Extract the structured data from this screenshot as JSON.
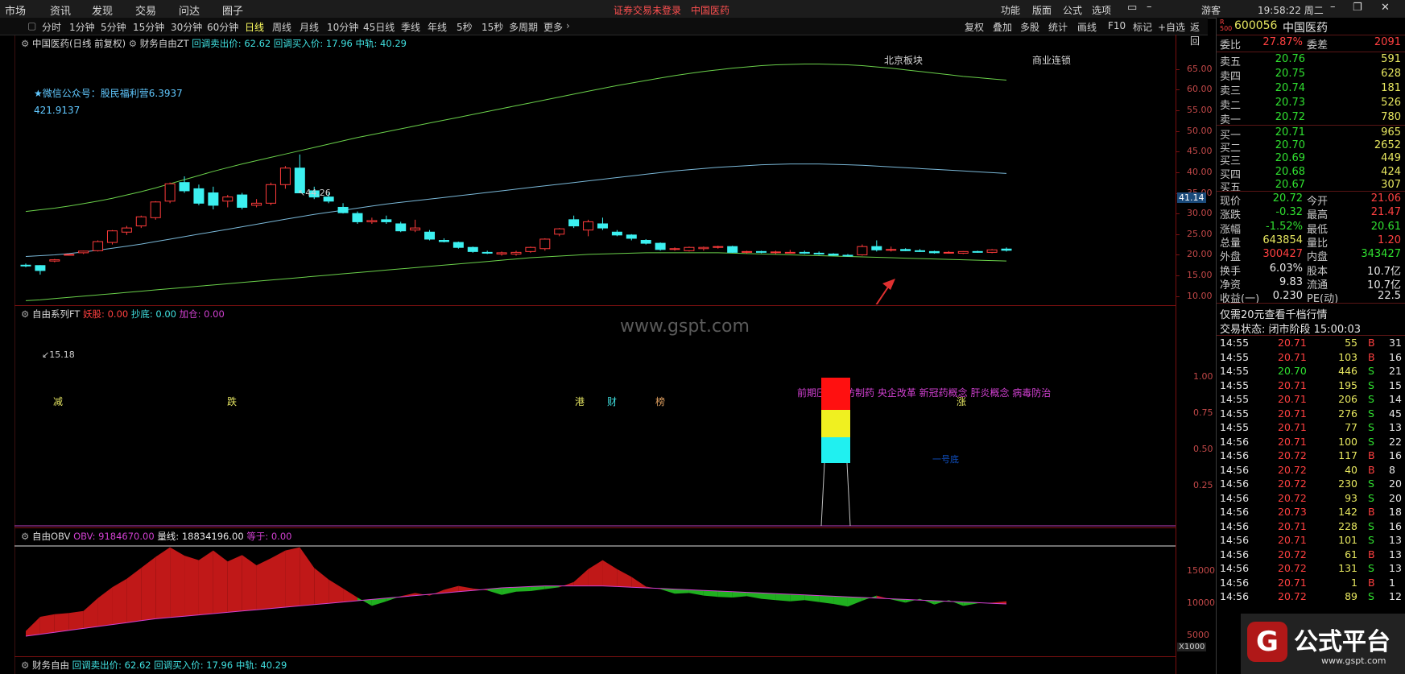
{
  "menu": {
    "items": [
      "市场",
      "资讯",
      "发现",
      "交易",
      "问达",
      "圈子"
    ],
    "notice": "证券交易未登录",
    "stock_title": "中国医药",
    "right_items": [
      "功能",
      "版面",
      "公式",
      "选项"
    ],
    "user": "游客",
    "clock": "19:58:22 周二"
  },
  "toolbar": {
    "periods": [
      "分时",
      "1分钟",
      "5分钟",
      "15分钟",
      "30分钟",
      "60分钟",
      "日线",
      "周线",
      "月线",
      "10分钟",
      "45日线",
      "季线",
      "年线",
      "5秒",
      "15秒",
      "多周期",
      "更多"
    ],
    "active_period": "日线",
    "right_buttons": [
      "复权",
      "叠加",
      "多股",
      "统计",
      "画线",
      "F10",
      "标记",
      "+自选",
      "返回"
    ]
  },
  "main_chart": {
    "legend_name": "中国医药(日线 前复权)",
    "indicator": "财务自由ZT",
    "sell_label": "回调卖出价: 62.62",
    "buy_label": "回调买入价: 17.96",
    "mid_label": "中轨: 40.29",
    "wechat": "★微信公众号：股民福利营6.3937",
    "val_421": "421.9137",
    "high_label": "44.26",
    "low_label": "15.18",
    "price_tag": "41.14",
    "label_beijing": "北京板块",
    "label_commerce": "商业连锁",
    "concepts": "前期压力位仿制药 央企改革 新冠药概念 肝炎概念 病毒防治",
    "watermark": "www.gspt.com",
    "markers": [
      {
        "t": "减",
        "c": "#e0e060"
      },
      {
        "t": "跌",
        "c": "#e0e060"
      },
      {
        "t": "港",
        "c": "#e0e060"
      },
      {
        "t": "财",
        "c": "#e0e060"
      },
      {
        "t": "榜",
        "c": "#e0e060"
      },
      {
        "t": "涨",
        "c": "#e0e060"
      }
    ],
    "ticks": [
      "65.00",
      "60.00",
      "55.00",
      "50.00",
      "45.00",
      "40.00",
      "35.00",
      "30.00",
      "25.00",
      "20.00",
      "15.00",
      "10.00"
    ]
  },
  "panel2": {
    "name": "自由系列FT",
    "a": "妖股: 0.00",
    "b": "抄底: 0.00",
    "c": "加仓: 0.00",
    "label": "一号底",
    "ticks": [
      "1.00",
      "0.75",
      "0.50",
      "0.25"
    ]
  },
  "panel3": {
    "name": "自由OBV",
    "obv": "OBV: 9184670.00",
    "vol": "量线: 18834196.00",
    "eq": "等于: 0.00",
    "ticks": [
      "15000",
      "10000",
      "5000"
    ],
    "unit": "X1000"
  },
  "panel4": {
    "name": "财务自由",
    "sell": "回调卖出价: 62.62",
    "buy": "回调买入价: 17.96",
    "mid": "中轨: 40.29"
  },
  "colors": {
    "up": "#ff3b3b",
    "down": "#3cf0f0",
    "green": "#30c030",
    "yellow": "#e8e83c"
  },
  "chart_data": {
    "type": "candlestick",
    "title": "中国医药(日线 前复权)",
    "ylim": [
      8,
      70
    ],
    "candles": [
      [
        17.5,
        17.9,
        17.0,
        17.3
      ],
      [
        17.4,
        17.5,
        15.2,
        16.2
      ],
      [
        18.5,
        19.0,
        18.2,
        18.8
      ],
      [
        20.0,
        20.2,
        19.8,
        20.1
      ],
      [
        20.5,
        21.0,
        20.2,
        20.9
      ],
      [
        21.0,
        23.5,
        20.8,
        23.2
      ],
      [
        23.0,
        26.0,
        22.5,
        25.8
      ],
      [
        25.5,
        27.0,
        24.8,
        26.5
      ],
      [
        27.0,
        29.5,
        26.5,
        29.2
      ],
      [
        29.0,
        33.0,
        28.5,
        32.8
      ],
      [
        33.0,
        37.5,
        32.5,
        37.2
      ],
      [
        37.5,
        39.0,
        35.0,
        35.5
      ],
      [
        36.0,
        37.0,
        32.0,
        32.5
      ],
      [
        35.0,
        36.5,
        31.0,
        32.0
      ],
      [
        33.0,
        34.5,
        31.5,
        34.0
      ],
      [
        34.5,
        35.0,
        31.0,
        31.5
      ],
      [
        32.0,
        33.5,
        31.5,
        32.5
      ],
      [
        32.5,
        37.5,
        32.0,
        37.0
      ],
      [
        37.0,
        41.5,
        36.0,
        41.0
      ],
      [
        41.0,
        44.3,
        40.5,
        35.0
      ],
      [
        35.5,
        36.5,
        33.5,
        34.0
      ],
      [
        34.0,
        35.0,
        32.5,
        33.0
      ],
      [
        31.5,
        32.5,
        30.0,
        30.2
      ],
      [
        30.0,
        30.5,
        27.5,
        28.0
      ],
      [
        28.0,
        29.0,
        27.5,
        28.3
      ],
      [
        28.5,
        29.5,
        27.5,
        28.0
      ],
      [
        27.5,
        28.0,
        25.5,
        25.8
      ],
      [
        26.0,
        28.5,
        25.5,
        26.5
      ],
      [
        25.5,
        26.0,
        23.5,
        23.8
      ],
      [
        23.5,
        24.0,
        23.0,
        23.2
      ],
      [
        23.0,
        23.2,
        21.5,
        21.8
      ],
      [
        21.8,
        22.0,
        20.5,
        20.8
      ],
      [
        20.6,
        21.0,
        20.2,
        20.4
      ],
      [
        20.2,
        20.8,
        19.8,
        20.5
      ],
      [
        20.2,
        21.0,
        19.8,
        20.6
      ],
      [
        20.8,
        22.0,
        20.5,
        21.8
      ],
      [
        21.5,
        24.0,
        21.0,
        23.8
      ],
      [
        25.0,
        26.5,
        24.5,
        26.3
      ],
      [
        28.5,
        29.5,
        26.5,
        27.0
      ],
      [
        26.0,
        28.5,
        24.5,
        28.0
      ],
      [
        27.5,
        29.0,
        26.0,
        26.5
      ],
      [
        25.5,
        26.0,
        24.5,
        24.8
      ],
      [
        24.8,
        25.0,
        23.5,
        24.0
      ],
      [
        23.5,
        23.8,
        22.5,
        22.8
      ],
      [
        22.8,
        23.0,
        21.0,
        21.3
      ],
      [
        21.3,
        21.8,
        21.0,
        21.5
      ],
      [
        21.0,
        22.0,
        20.8,
        21.8
      ],
      [
        21.5,
        22.0,
        21.0,
        21.8
      ],
      [
        21.8,
        22.2,
        21.5,
        22.0
      ],
      [
        22.0,
        22.2,
        20.5,
        20.6
      ],
      [
        20.6,
        21.0,
        20.3,
        20.8
      ],
      [
        20.8,
        21.0,
        20.4,
        20.6
      ],
      [
        20.6,
        21.0,
        20.2,
        20.7
      ],
      [
        20.6,
        21.2,
        20.3,
        20.6
      ],
      [
        20.6,
        21.0,
        20.2,
        20.4
      ],
      [
        20.4,
        20.8,
        20.0,
        20.2
      ],
      [
        20.2,
        20.4,
        19.8,
        19.9
      ],
      [
        19.9,
        20.2,
        19.6,
        19.8
      ],
      [
        20.0,
        22.5,
        19.8,
        22.0
      ],
      [
        22.0,
        23.5,
        20.8,
        21.2
      ],
      [
        21.2,
        22.0,
        20.8,
        21.3
      ],
      [
        21.3,
        21.6,
        20.9,
        21.0
      ],
      [
        21.0,
        21.4,
        20.7,
        20.8
      ],
      [
        20.8,
        21.0,
        20.3,
        20.5
      ],
      [
        20.5,
        20.9,
        20.3,
        20.6
      ],
      [
        20.4,
        20.9,
        20.2,
        20.8
      ],
      [
        20.8,
        21.0,
        20.5,
        20.7
      ],
      [
        20.6,
        21.4,
        20.4,
        21.2
      ],
      [
        21.4,
        21.8,
        20.8,
        21.1
      ]
    ],
    "upper_band": [
      30.5,
      30.9,
      31.3,
      31.8,
      32.4,
      33,
      33.7,
      34.5,
      35.3,
      36.2,
      37.2,
      38.2,
      39.2,
      40.2,
      41.1,
      42,
      42.8,
      43.6,
      44.4,
      45.2,
      46,
      46.8,
      47.6,
      48.4,
      49.1,
      49.8,
      50.5,
      51.2,
      51.9,
      52.6,
      53.3,
      54,
      54.7,
      55.4,
      56.1,
      56.8,
      57.5,
      58.2,
      58.9,
      59.6,
      60.3,
      61,
      61.6,
      62.2,
      62.8,
      63.4,
      63.9,
      64.4,
      64.8,
      65.2,
      65.5,
      65.8,
      66,
      66.1,
      66.2,
      66.2,
      66.1,
      66,
      65.8,
      65.5,
      65.2,
      64.8,
      64.4,
      64,
      63.6,
      63.2,
      62.9,
      62.6,
      62.3
    ],
    "mid_band": [
      19.6,
      19.8,
      20.0,
      20.3,
      20.7,
      21.1,
      21.6,
      22.1,
      22.6,
      23.2,
      23.8,
      24.4,
      25,
      25.6,
      26.2,
      26.8,
      27.4,
      28,
      28.6,
      29.2,
      29.8,
      30.3,
      30.8,
      31.3,
      31.8,
      32.3,
      32.7,
      33.1,
      33.5,
      33.9,
      34.3,
      34.7,
      35.1,
      35.5,
      35.9,
      36.3,
      36.7,
      37.1,
      37.5,
      37.9,
      38.3,
      38.7,
      39.1,
      39.5,
      39.9,
      40.3,
      40.6,
      40.9,
      41.2,
      41.4,
      41.6,
      41.8,
      41.9,
      42,
      42,
      42,
      41.9,
      41.8,
      41.7,
      41.5,
      41.3,
      41.1,
      40.9,
      40.7,
      40.5,
      40.3,
      40.1,
      39.9,
      39.7
    ],
    "lower_band": [
      8.9,
      9.1,
      9.4,
      9.7,
      10,
      10.3,
      10.6,
      10.9,
      11.2,
      11.5,
      11.8,
      12.1,
      12.4,
      12.7,
      13,
      13.3,
      13.6,
      13.9,
      14.2,
      14.5,
      14.8,
      15.1,
      15.4,
      15.7,
      16,
      16.3,
      16.6,
      16.9,
      17.2,
      17.5,
      17.8,
      18.1,
      18.4,
      18.7,
      19,
      19.3,
      19.5,
      19.7,
      19.9,
      20.1,
      20.2,
      20.3,
      20.4,
      20.5,
      20.5,
      20.5,
      20.5,
      20.5,
      20.5,
      20.4,
      20.3,
      20.2,
      20.1,
      20,
      19.9,
      19.8,
      19.7,
      19.6,
      19.5,
      19.4,
      19.3,
      19.2,
      19.1,
      19,
      18.9,
      18.8,
      18.7,
      18.6,
      18.5
    ],
    "obv": [
      5800,
      8000,
      8400,
      8600,
      8900,
      10900,
      12600,
      13900,
      15600,
      17300,
      18800,
      17500,
      16800,
      18300,
      16600,
      17600,
      16000,
      17100,
      18300,
      18800,
      15600,
      13800,
      12400,
      11000,
      9700,
      10400,
      11200,
      11700,
      11300,
      12200,
      12800,
      12400,
      12100,
      11400,
      11900,
      12000,
      12300,
      12600,
      13400,
      15400,
      16800,
      15400,
      14200,
      12700,
      12300,
      11600,
      11700,
      11300,
      11100,
      11000,
      11200,
      10800,
      10600,
      10400,
      10600,
      10300,
      10000,
      9600,
      10500,
      11300,
      10700,
      10200,
      10800,
      9900,
      10600,
      9700,
      10100,
      10200,
      10400
    ],
    "obv_ma": [
      5000,
      5300,
      5600,
      5900,
      6200,
      6500,
      6800,
      7100,
      7400,
      7700,
      7900,
      8100,
      8300,
      8500,
      8700,
      8900,
      9100,
      9300,
      9500,
      9700,
      9900,
      10100,
      10300,
      10500,
      10700,
      10900,
      11100,
      11300,
      11500,
      11700,
      11900,
      12100,
      12300,
      12500,
      12600,
      12700,
      12800,
      12800,
      12800,
      12800,
      12800,
      12700,
      12600,
      12500,
      12400,
      12300,
      12200,
      12100,
      12000,
      11900,
      11800,
      11700,
      11600,
      11500,
      11400,
      11300,
      11200,
      11100,
      11000,
      10900,
      10800,
      10700,
      10600,
      10500,
      10400,
      10300,
      10200,
      10100,
      10000
    ]
  },
  "quote": {
    "code": "600056",
    "name": "中国医药",
    "weibi_l": "委比",
    "weibi": "27.87%",
    "weicha_l": "委差",
    "weicha": "2091",
    "sells": [
      [
        "卖五",
        "20.76",
        "591"
      ],
      [
        "卖四",
        "20.75",
        "628"
      ],
      [
        "卖三",
        "20.74",
        "181"
      ],
      [
        "卖二",
        "20.73",
        "526"
      ],
      [
        "卖一",
        "20.72",
        "780"
      ]
    ],
    "buys": [
      [
        "买一",
        "20.71",
        "965"
      ],
      [
        "买二",
        "20.70",
        "2652"
      ],
      [
        "买三",
        "20.69",
        "449"
      ],
      [
        "买四",
        "20.68",
        "424"
      ],
      [
        "买五",
        "20.67",
        "307"
      ]
    ],
    "stats": [
      [
        "现价",
        "20.72",
        "今开",
        "21.06"
      ],
      [
        "涨跌",
        "-0.32",
        "最高",
        "21.47"
      ],
      [
        "涨幅",
        "-1.52%",
        "最低",
        "20.61"
      ],
      [
        "总量",
        "643854",
        "量比",
        "1.20"
      ],
      [
        "外盘",
        "300427",
        "内盘",
        "343427"
      ],
      [
        "换手",
        "6.03%",
        "股本",
        "10.7亿"
      ],
      [
        "净资",
        "9.83",
        "流通",
        "10.7亿"
      ],
      [
        "收益(一)",
        "0.230",
        "PE(动)",
        "22.5"
      ]
    ],
    "promo": "仅需20元查看千档行情",
    "status": "交易状态: 闭市阶段 15:00:03",
    "ticks": [
      [
        "14:55",
        "20.71",
        "55",
        "B",
        "31"
      ],
      [
        "14:55",
        "20.71",
        "103",
        "B",
        "16"
      ],
      [
        "14:55",
        "20.70",
        "446",
        "S",
        "21"
      ],
      [
        "14:55",
        "20.71",
        "195",
        "S",
        "15"
      ],
      [
        "14:55",
        "20.71",
        "206",
        "S",
        "14"
      ],
      [
        "14:55",
        "20.71",
        "276",
        "S",
        "45"
      ],
      [
        "14:55",
        "20.71",
        "77",
        "S",
        "13"
      ],
      [
        "14:56",
        "20.71",
        "100",
        "S",
        "22"
      ],
      [
        "14:56",
        "20.72",
        "117",
        "B",
        "16"
      ],
      [
        "14:56",
        "20.72",
        "40",
        "B",
        "8"
      ],
      [
        "14:56",
        "20.72",
        "230",
        "S",
        "20"
      ],
      [
        "14:56",
        "20.72",
        "93",
        "S",
        "20"
      ],
      [
        "14:56",
        "20.73",
        "142",
        "B",
        "18"
      ],
      [
        "14:56",
        "20.71",
        "228",
        "S",
        "16"
      ],
      [
        "14:56",
        "20.71",
        "101",
        "S",
        "13"
      ],
      [
        "14:56",
        "20.72",
        "61",
        "B",
        "13"
      ],
      [
        "14:56",
        "20.72",
        "131",
        "S",
        "13"
      ],
      [
        "14:56",
        "20.71",
        "1",
        "B",
        "1"
      ],
      [
        "14:56",
        "20.72",
        "89",
        "S",
        "12"
      ]
    ]
  },
  "brand": {
    "name": "公式平台",
    "url": "www.gspt.com"
  }
}
